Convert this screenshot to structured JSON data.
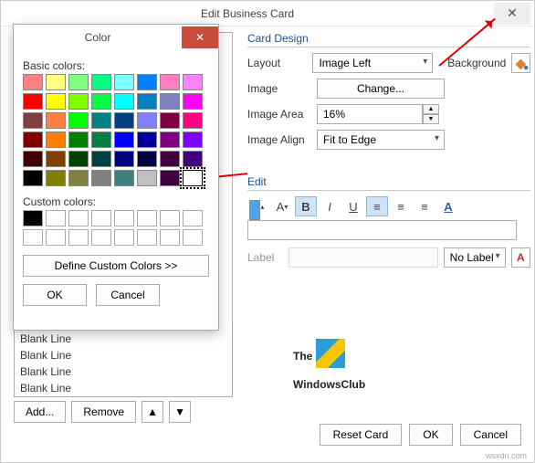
{
  "dialog": {
    "title": "Edit Business Card"
  },
  "card_design": {
    "header": "Card Design",
    "layout_label": "Layout",
    "layout_value": "Image Left",
    "background_label": "Background",
    "image_label": "Image",
    "change_label": "Change...",
    "image_area_label": "Image Area",
    "image_area_value": "16%",
    "image_align_label": "Image Align",
    "image_align_value": "Fit to Edge"
  },
  "edit": {
    "header": "Edit",
    "label_caption": "Label",
    "no_label": "No Label"
  },
  "field_list": {
    "items": [
      "Blank Line",
      "Blank Line",
      "Blank Line",
      "Blank Line",
      "Blank Line"
    ],
    "add": "Add...",
    "remove": "Remove"
  },
  "color_dialog": {
    "title": "Color",
    "basic_label": "Basic colors:",
    "custom_label": "Custom colors:",
    "define": "Define Custom Colors >>",
    "ok": "OK",
    "cancel": "Cancel",
    "basic": [
      "#ff8080",
      "#ffff80",
      "#80ff80",
      "#00ff80",
      "#80ffff",
      "#0080ff",
      "#ff80c0",
      "#ff80ff",
      "#ff0000",
      "#ffff00",
      "#80ff00",
      "#00ff40",
      "#00ffff",
      "#0080c0",
      "#8080c0",
      "#ff00ff",
      "#804040",
      "#ff8040",
      "#00ff00",
      "#008080",
      "#004080",
      "#8080ff",
      "#800040",
      "#ff0080",
      "#800000",
      "#ff8000",
      "#008000",
      "#008040",
      "#0000ff",
      "#0000a0",
      "#800080",
      "#8000ff",
      "#400000",
      "#804000",
      "#004000",
      "#004040",
      "#000080",
      "#000040",
      "#400040",
      "#400080",
      "#000000",
      "#808000",
      "#808040",
      "#808080",
      "#408080",
      "#c0c0c0",
      "#400040",
      "#ffffff"
    ],
    "selected_index": 47
  },
  "bottom": {
    "reset": "Reset Card",
    "ok": "OK",
    "cancel": "Cancel"
  },
  "logo": {
    "line1": "The",
    "line2": "WindowsClub"
  },
  "footer": "wsxdn.com"
}
